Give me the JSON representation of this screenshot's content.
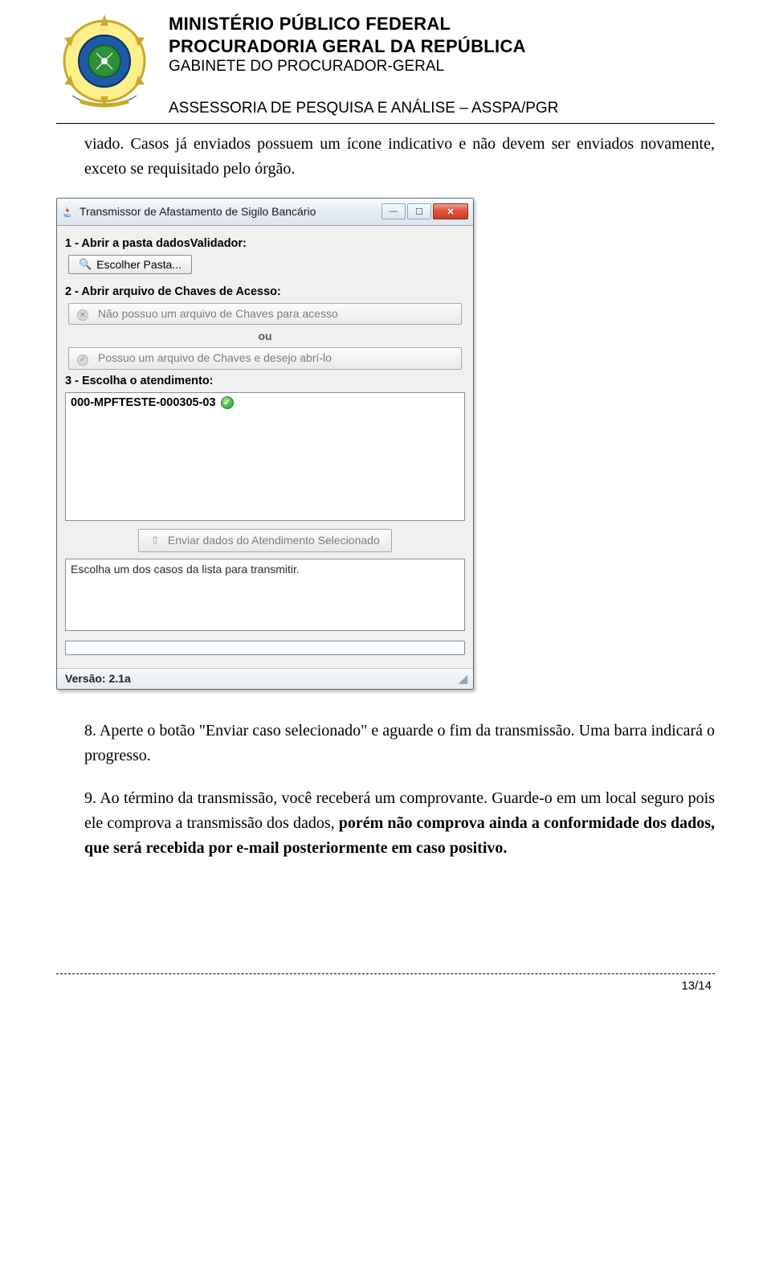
{
  "header": {
    "line1": "MINISTÉRIO PÚBLICO FEDERAL",
    "line2": "PROCURADORIA GERAL DA REPÚBLICA",
    "line3": "GABINETE DO PROCURADOR-GERAL",
    "subheader": "ASSESSORIA DE PESQUISA E ANÁLISE – ASSPA/PGR"
  },
  "paragraph_intro": "viado. Casos já enviados possuem um ícone indicativo e não devem ser enviados novamente, exceto se requisitado pelo órgão.",
  "screenshot": {
    "window_title": "Transmissor de Afastamento de Sigilo Bancário",
    "step1_label": "1 - Abrir a pasta dadosValidador:",
    "choose_folder": "Escolher Pasta...",
    "step2_label": "2 - Abrir arquivo de Chaves de Acesso:",
    "no_key_file": "Não possuo um arquivo de Chaves para acesso",
    "ou": "ou",
    "has_key_file": "Possuo um arquivo de Chaves e desejo abrí-lo",
    "step3_label": "3 - Escolha o atendimento:",
    "list_item": "000-MPFTESTE-000305-03",
    "send_button": "Enviar dados do Atendimento Selecionado",
    "status_msg": "Escolha um dos casos da lista para transmitir.",
    "version": "Versão: 2.1a"
  },
  "item8": "8. Aperte o botão \"Enviar caso selecionado\" e aguarde o fim da transmissão. Uma barra indicará o progresso.",
  "item9_a": "9. Ao término da transmissão, você receberá um comprovante. Guarde-o em um local seguro pois ele comprova a transmissão dos dados, ",
  "item9_bold": "porém não comprova ainda a conformidade dos dados, que será recebida por e-mail posteriormente em caso positivo.",
  "page_number": "13/14"
}
